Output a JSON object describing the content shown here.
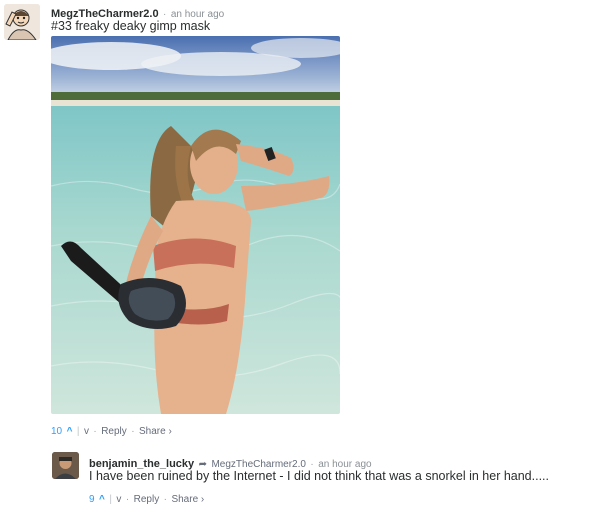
{
  "comments": [
    {
      "author": "MegzTheCharmer2.0",
      "timestamp": "an hour ago",
      "text": "#33 freaky deaky gimp mask",
      "votes": {
        "up_count": "10",
        "up_icon": "^",
        "down_icon": "v"
      },
      "actions": {
        "reply": "Reply",
        "share": "Share ›"
      }
    },
    {
      "author": "benjamin_the_lucky",
      "in_reply_to": "MegzTheCharmer2.0",
      "timestamp": "an hour ago",
      "text": "I have been ruined by the Internet - I did not think that was a snorkel in her hand.....",
      "votes": {
        "up_count": "9",
        "up_icon": "^",
        "down_icon": "v"
      },
      "actions": {
        "reply": "Reply",
        "share": "Share ›"
      }
    }
  ],
  "separators": {
    "dot": "·",
    "bar": "|"
  },
  "colors": {
    "upvote_blue": "#2e9fff",
    "text_dark": "#2a2e2e",
    "meta_gray": "#8a9094"
  }
}
